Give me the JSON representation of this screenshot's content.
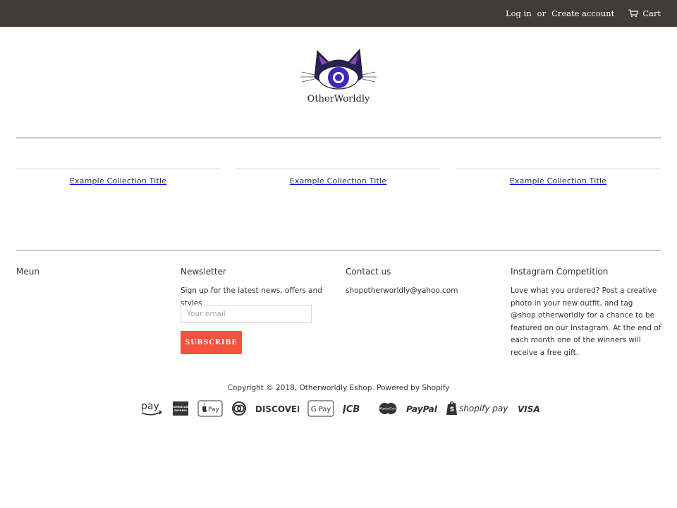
{
  "topbar": {
    "login_label": "Log in",
    "or_label": "or",
    "create_account_label": "Create account",
    "cart_label": "Cart",
    "background": "#413c38"
  },
  "logo": {
    "text": "OtherWorldly",
    "colors": {
      "eye_outer": "#2a1f5e",
      "iris": "#3b2bb8",
      "pupil_ring": "#ffffff"
    }
  },
  "collections": [
    {
      "title": "Example Collection Title"
    },
    {
      "title": "Example Collection Title"
    },
    {
      "title": "Example Collection Title"
    }
  ],
  "footer": {
    "menu": {
      "heading": "Meun"
    },
    "newsletter": {
      "heading": "Newsletter",
      "text": "Sign up for the latest news, offers and styles",
      "email_placeholder": "Your email",
      "subscribe_label": "Subscribe"
    },
    "contact": {
      "heading": "Contact us",
      "email": "shopotherworldly@yahoo.com"
    },
    "instagram": {
      "heading": "Instagram Competition",
      "text": "Love what you ordered? Post a creative photo in your new outfit, and tag @shop.otherworldly for a chance to be featured on our Instagram. At the end of each month one of the winners will receive a free gift."
    },
    "copyright": "Copyright © 2018, Otherworldly Eshop. Powered by Shopify"
  },
  "payments": [
    {
      "name": "amazon-pay-icon",
      "label": "pay"
    },
    {
      "name": "american-express-icon",
      "label": "AMERICAN EXPRESS"
    },
    {
      "name": "apple-pay-icon",
      "label": "Pay"
    },
    {
      "name": "diners-club-icon",
      "label": ""
    },
    {
      "name": "discover-icon",
      "label": "DISCOVER"
    },
    {
      "name": "google-pay-icon",
      "label": "G Pay"
    },
    {
      "name": "jcb-icon",
      "label": "JCB"
    },
    {
      "name": "mastercard-icon",
      "label": "MasterCard"
    },
    {
      "name": "paypal-icon",
      "label": "PayPal"
    },
    {
      "name": "shopify-pay-icon",
      "label": "shopify pay"
    },
    {
      "name": "visa-icon",
      "label": "VISA"
    }
  ],
  "accent": "#f2523e"
}
